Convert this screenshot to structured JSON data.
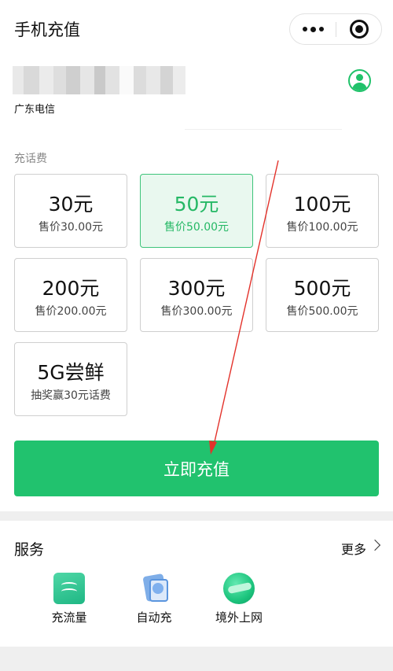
{
  "app": {
    "title": "手机充值"
  },
  "capsule": {
    "more_icon": "more-dots-icon",
    "close_icon": "target-close-icon"
  },
  "account": {
    "carrier": "广东电信",
    "contact_icon": "person-icon"
  },
  "plan_section": {
    "label": "充话费"
  },
  "options": [
    {
      "amount": "30元",
      "price": "售价30.00元",
      "selected": false
    },
    {
      "amount": "50元",
      "price": "售价50.00元",
      "selected": true
    },
    {
      "amount": "100元",
      "price": "售价100.00元",
      "selected": false
    },
    {
      "amount": "200元",
      "price": "售价200.00元",
      "selected": false
    },
    {
      "amount": "300元",
      "price": "售价300.00元",
      "selected": false
    },
    {
      "amount": "500元",
      "price": "售价500.00元",
      "selected": false
    },
    {
      "amount": "5G尝鲜",
      "price": "抽奖赢30元话费",
      "selected": false
    }
  ],
  "recharge_button": {
    "label": "立即充值"
  },
  "services": {
    "title": "服务",
    "more": "更多",
    "items": [
      {
        "label": "充流量",
        "icon": "data-flow-icon"
      },
      {
        "label": "自动充",
        "icon": "auto-recharge-icon"
      },
      {
        "label": "境外上网",
        "icon": "globe-icon"
      }
    ]
  },
  "colors": {
    "accent": "#21c26e",
    "selected_bg": "#e9f8ef",
    "annotation_arrow": "#e3322b"
  }
}
